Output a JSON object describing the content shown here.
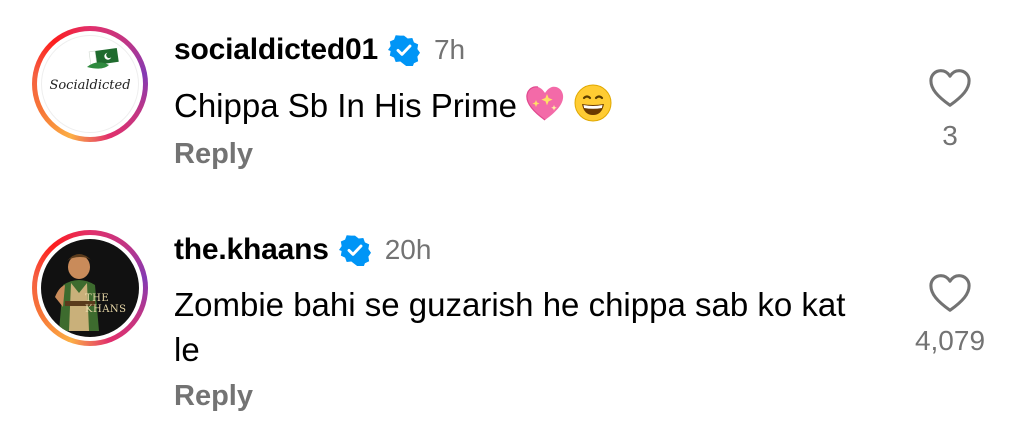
{
  "comments": [
    {
      "username": "socialdicted01",
      "time": "7h",
      "text": "Chippa Sb In His Prime",
      "emojis": [
        "sparkling-heart",
        "grinning-face"
      ],
      "avatar_text": "Socialdicted",
      "reply_label": "Reply",
      "like_count": "3",
      "verified": true
    },
    {
      "username": "the.khaans",
      "time": "20h",
      "text": "Zombie bahi se guzarish he chippa sab ko kat le",
      "avatar_text": "THE KHANS",
      "reply_label": "Reply",
      "like_count": "4,079",
      "verified": true
    }
  ],
  "colors": {
    "verified_blue": "#0095f6",
    "secondary_text": "#737373",
    "primary_text": "#000000"
  },
  "icons": [
    "verified-badge-icon",
    "heart-outline-icon"
  ]
}
